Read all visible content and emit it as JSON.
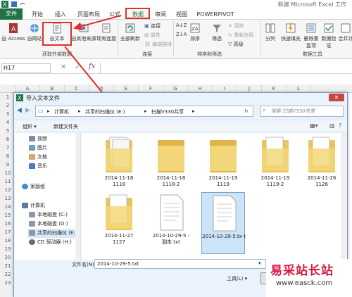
{
  "app": {
    "title": "新建 Microsoft Excel 工作"
  },
  "ribbon_tabs": [
    "文件",
    "开始",
    "插入",
    "页面布局",
    "公式",
    "数据",
    "审阅",
    "视图",
    "POWERPIVOT"
  ],
  "ribbon": {
    "access": "自 Access",
    "web": "自网站",
    "fromtext": "自文本",
    "othersource": "自其他来源",
    "existing": "现有连接",
    "group_external": "获取外部数据",
    "refresh_all": "全部刷新",
    "conn": "连接",
    "props": "属性",
    "editlinks": "编辑链接",
    "group_conn": "连接",
    "sort": "排序",
    "filter": "筛选",
    "clear": "清除",
    "reapply": "重新应用",
    "advanced": "高级",
    "group_sort": "排序和筛选",
    "split": "分列",
    "flashfill": "快速填充",
    "removedup": "删除重复项",
    "validate": "数据验证",
    "consolidate": "合并计",
    "group_tools": "数据工具"
  },
  "namebox": "H17",
  "fx": "fx",
  "columns": [
    "A",
    "B",
    "C",
    "D",
    "E",
    "F",
    "G",
    "H",
    "I",
    "J",
    "K",
    "L"
  ],
  "rows": [
    "1",
    "2",
    "3",
    "4",
    "5",
    "6",
    "7",
    "8",
    "9",
    "10",
    "11",
    "12",
    "13",
    "14",
    "15",
    "16",
    "17",
    "18",
    "19",
    "20",
    "21",
    "22",
    "23"
  ],
  "dialog": {
    "title": "导入文本文件",
    "path": [
      "计算机",
      "共享的扫描仪 (E:)",
      "扫描V330共享"
    ],
    "search_placeholder": "搜索 扫描V330共享",
    "organize": "组织 ▾",
    "newfolder": "新建文件夹",
    "nav": [
      {
        "label": "视频",
        "color": "#7a8fb0"
      },
      {
        "label": "图片",
        "color": "#6aa0c8"
      },
      {
        "label": "文档",
        "color": "#c9b06a"
      },
      {
        "label": "音乐",
        "color": "#4a78c2"
      },
      {
        "label": "家庭组",
        "color": "#3a8fd0"
      },
      {
        "label": "计算机",
        "color": "#5a7aa8"
      },
      {
        "label": "本地磁盘 (C:)",
        "color": "#8a9aaa"
      },
      {
        "label": "本地磁盘 (D:)",
        "color": "#8a9aaa"
      },
      {
        "label": "共享的扫描仪 (E:",
        "color": "#8a9aaa"
      },
      {
        "label": "CD 驱动器 (H:)",
        "color": "#6a6a6a"
      }
    ],
    "files": [
      {
        "label": "2014-11-18\n1118",
        "kind": "folder-docs"
      },
      {
        "label": "2014-11-18\n1118-2",
        "kind": "folder"
      },
      {
        "label": "2014-11-19\n1119",
        "kind": "folder"
      },
      {
        "label": "2014-11-19\n1119-2",
        "kind": "folder-docs"
      },
      {
        "label": "2014-11-26\n1126",
        "kind": "folder-docs"
      },
      {
        "label": "2014-11-27\n1127",
        "kind": "folder-docs"
      },
      {
        "label": "2014-10-29-5 -\n副本.txt",
        "kind": "txt"
      },
      {
        "label": "2014-10-29-5.tx\nt",
        "kind": "txt"
      }
    ],
    "filename_label": "文件名(N):",
    "filename_value": "2014-10-29-5.txt",
    "tools": "工具(L)",
    "tools_arrow": "▾"
  },
  "watermark": {
    "line1": "易采站长站",
    "line2": "www.easck.com"
  },
  "colors": {
    "excel_green": "#217346",
    "highlight": "#e0302a",
    "selection": "#cce4f7"
  }
}
